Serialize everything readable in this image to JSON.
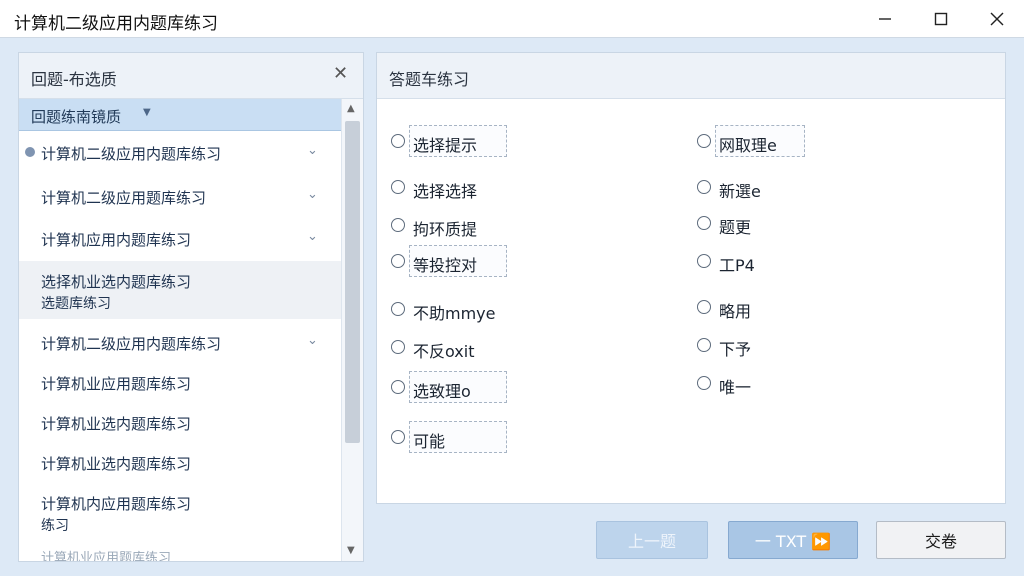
{
  "window": {
    "title": "计算机二级应用内题库练习",
    "minimize_icon": "minimize-icon",
    "maximize_icon": "maximize-icon",
    "close_icon": "close-icon"
  },
  "left_panel": {
    "title": "回题-布选质",
    "close_glyph": "✕",
    "dropdown": {
      "label": "回题练南镜质",
      "caret": "▼"
    },
    "items": [
      {
        "label": "计算机二级应用内题库练习",
        "label2": "",
        "chevron": "⌄"
      },
      {
        "label": "计算机二级应用题库练习",
        "label2": "",
        "chevron": "⌄"
      },
      {
        "label": "计算机应用内题库练习",
        "label2": "",
        "chevron": "⌄"
      },
      {
        "label": "选择机业选内题库练习",
        "label2": "选题库练习",
        "chevron": ""
      },
      {
        "label": "计算机二级应用内题库练习",
        "label2": "",
        "chevron": "⌄"
      },
      {
        "label": "计算机业应用题库练习",
        "label2": "",
        "chevron": ""
      },
      {
        "label": "计算机业选内题库练习",
        "label2": "",
        "chevron": ""
      },
      {
        "label": "计算机业选内题库练习",
        "label2": "",
        "chevron": ""
      },
      {
        "label": "计算机内应用题库练习",
        "label2": "练习",
        "chevron": ""
      },
      {
        "label": "计算机业应用题库练习",
        "label2": "",
        "chevron": ""
      }
    ]
  },
  "right_panel": {
    "title": "答题车练习",
    "options_left": [
      {
        "text": "选择提示",
        "boxed": true
      },
      {
        "text": "选择选择",
        "boxed": false
      },
      {
        "text": "拘环质提",
        "boxed": false
      },
      {
        "text": "等投控对",
        "boxed": true
      },
      {
        "text": "不助mmye",
        "boxed": false
      },
      {
        "text": "不反oxit",
        "boxed": false
      },
      {
        "text": "选致理o",
        "boxed": true
      },
      {
        "text": "可能",
        "boxed": true
      }
    ],
    "options_right": [
      {
        "text": "网取理e",
        "boxed": true
      },
      {
        "text": "新選e",
        "boxed": false
      },
      {
        "text": "题更",
        "boxed": false
      },
      {
        "text": "工P4",
        "boxed": false
      },
      {
        "text": "略用",
        "boxed": false
      },
      {
        "text": "下予",
        "boxed": false
      },
      {
        "text": "唯一",
        "boxed": false
      }
    ]
  },
  "buttons": {
    "prev": "上一题",
    "next": "一 TXT ⏩",
    "submit": "交卷"
  },
  "colors": {
    "background": "#dde9f6",
    "dropdown_highlight": "#c9def3",
    "next_button": "#a9c6e5",
    "prev_button": "#bdd4ec"
  }
}
